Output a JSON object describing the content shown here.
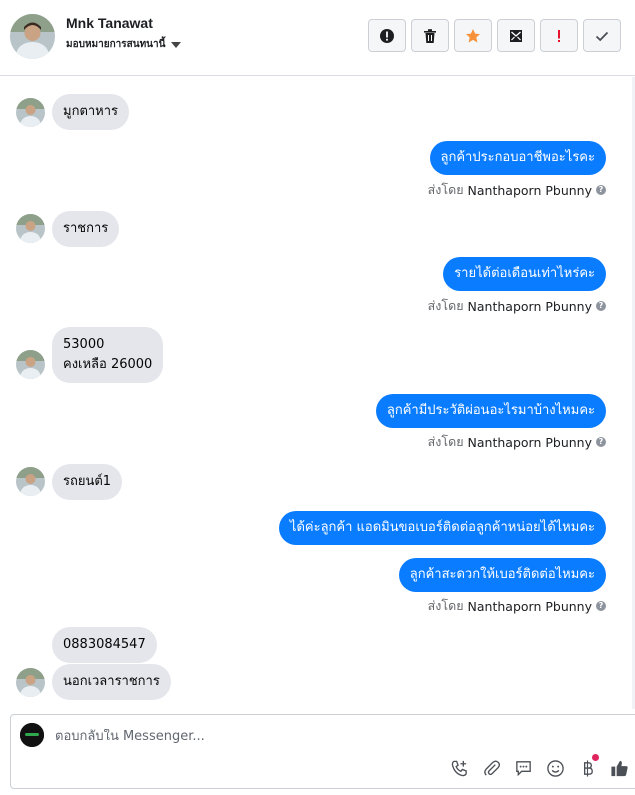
{
  "header": {
    "name": "Mnk Tanawat",
    "status": "มอบหมายการสนทนานี้",
    "toolbar": [
      {
        "icon": "alert-circle-icon",
        "label": "spam"
      },
      {
        "icon": "trash-icon",
        "label": "delete"
      },
      {
        "icon": "star-icon",
        "label": "follow up"
      },
      {
        "icon": "mark-unread-icon",
        "label": "mark unread"
      },
      {
        "icon": "exclamation-icon",
        "label": "priority"
      },
      {
        "icon": "check-icon",
        "label": "done"
      }
    ]
  },
  "messages": [
    {
      "dir": "in",
      "text": "มูกตาหาร"
    },
    {
      "dir": "out",
      "text": "ลูกค้าประกอบอาชีพอะไรคะ",
      "sent_by_prefix": "ส่งโดย",
      "sender": "Nanthaporn Pbunny"
    },
    {
      "dir": "in",
      "text": "ราชการ"
    },
    {
      "dir": "out",
      "text": "รายได้ต่อเดือนเท่าไหร่คะ",
      "sent_by_prefix": "ส่งโดย",
      "sender": "Nanthaporn Pbunny"
    },
    {
      "dir": "in",
      "text": "53000\nคงเหลือ 26000"
    },
    {
      "dir": "out",
      "text": "ลูกค้ามีประวัติผ่อนอะไรมาบ้างไหมคะ",
      "sent_by_prefix": "ส่งโดย",
      "sender": "Nanthaporn Pbunny"
    },
    {
      "dir": "in",
      "text": "รถยนต์1"
    },
    {
      "dir": "out",
      "text": "ได้ค่ะลูกค้า แอดมินขอเบอร์ติดต่อลูกค้าหน่อยได้ไหมคะ"
    },
    {
      "dir": "out",
      "text": "ลูกค้าสะดวกให้เบอร์ติดต่อไหมคะ",
      "sent_by_prefix": "ส่งโดย",
      "sender": "Nanthaporn Pbunny"
    },
    {
      "dir": "in",
      "text": "0883084547"
    },
    {
      "dir": "in",
      "text": "นอกเวลาราชการ"
    }
  ],
  "composer": {
    "placeholder": "ตอบกลับใน Messenger...",
    "tools": [
      "phone-add-icon",
      "paperclip-icon",
      "chat-bubble-icon",
      "emoji-icon",
      "baht-icon",
      "like-icon"
    ]
  },
  "colors": {
    "outgoing": "#0a7cff",
    "incoming": "#e4e6eb",
    "star": "#f7923a",
    "priority": "#e4162e"
  }
}
